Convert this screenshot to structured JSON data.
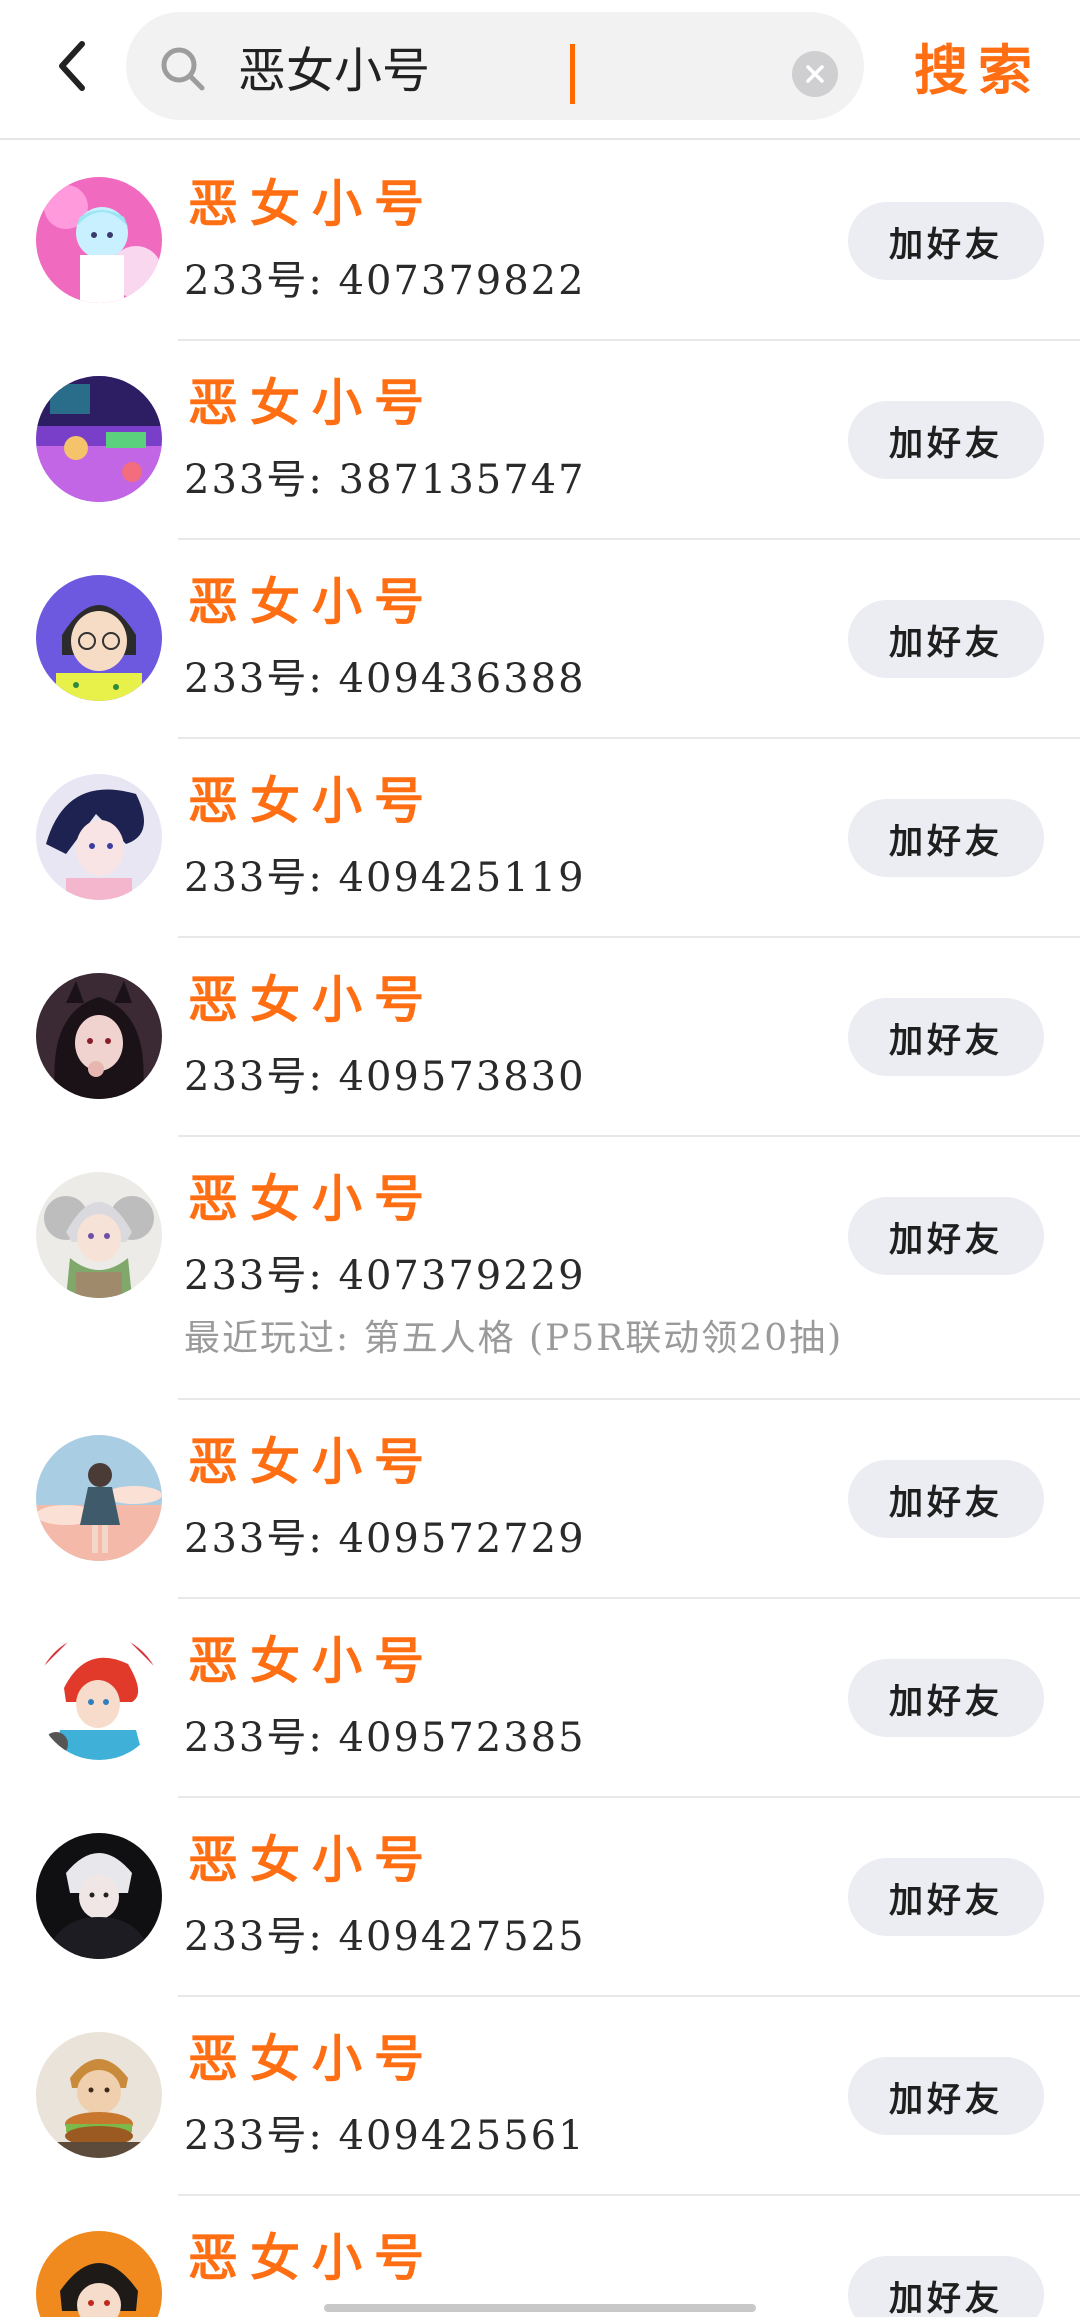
{
  "header": {
    "back_icon": "chevron-left-icon",
    "search": {
      "value": "恶女小号",
      "placeholder": "",
      "search_icon": "search-icon",
      "clear_icon": "clear-circle-icon"
    },
    "submit_label": "搜索",
    "accent_color": "#ff6e12"
  },
  "results": [
    {
      "name": "恶女小号",
      "uid": "233号: 407379822",
      "recent": "",
      "button": "加好友",
      "avatar": "avatar-pink-anime"
    },
    {
      "name": "恶女小号",
      "uid": "233号: 387135747",
      "recent": "",
      "button": "加好友",
      "avatar": "avatar-purple-room"
    },
    {
      "name": "恶女小号",
      "uid": "233号: 409436388",
      "recent": "",
      "button": "加好友",
      "avatar": "avatar-glasses-girl"
    },
    {
      "name": "恶女小号",
      "uid": "233号: 409425119",
      "recent": "",
      "button": "加好友",
      "avatar": "avatar-dark-hair-boy"
    },
    {
      "name": "恶女小号",
      "uid": "233号: 409573830",
      "recent": "",
      "button": "加好友",
      "avatar": "avatar-horned-girl"
    },
    {
      "name": "恶女小号",
      "uid": "233号: 407379229",
      "recent": "最近玩过: 第五人格 (P5R联动领20抽)",
      "button": "加好友",
      "avatar": "avatar-white-hair-scarf"
    },
    {
      "name": "恶女小号",
      "uid": "233号: 409572729",
      "recent": "",
      "button": "加好友",
      "avatar": "avatar-sky-girl"
    },
    {
      "name": "恶女小号",
      "uid": "233号: 409572385",
      "recent": "",
      "button": "加好友",
      "avatar": "avatar-red-hair-boy"
    },
    {
      "name": "恶女小号",
      "uid": "233号: 409427525",
      "recent": "",
      "button": "加好友",
      "avatar": "avatar-black-hood"
    },
    {
      "name": "恶女小号",
      "uid": "233号: 409425561",
      "recent": "",
      "button": "加好友",
      "avatar": "avatar-burger-boy"
    },
    {
      "name": "恶女小号",
      "uid": "",
      "recent": "",
      "button": "加好友",
      "avatar": "avatar-orange-hood"
    }
  ]
}
